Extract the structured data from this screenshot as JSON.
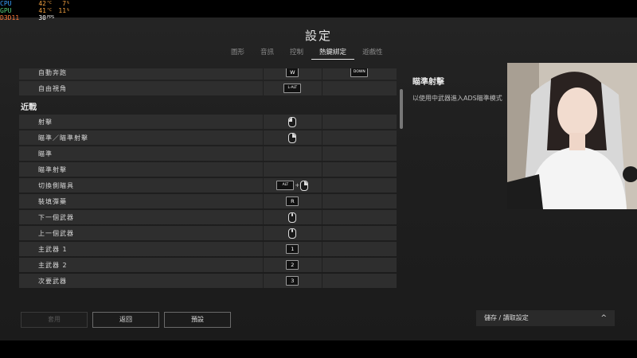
{
  "overlay": {
    "cpu": {
      "label": "CPU",
      "temp": "42",
      "load": "7"
    },
    "gpu": {
      "label": "GPU",
      "temp": "41",
      "load": "11"
    },
    "api": {
      "label": "D3D11",
      "fps": "30",
      "fps_unit": "FPS"
    },
    "temp_unit": "°C",
    "load_unit": "%"
  },
  "page_title": "設定",
  "tabs": [
    {
      "label": "圖形"
    },
    {
      "label": "音訊"
    },
    {
      "label": "控制"
    },
    {
      "label": "熱鍵綁定",
      "active": true
    },
    {
      "label": "遊戲性"
    }
  ],
  "bindings_top": [
    {
      "name": "自動奔跑",
      "key": "W",
      "key2": "DOWN"
    },
    {
      "name": "自由視角",
      "key": "L-ALT"
    }
  ],
  "section_label": "近戰",
  "bindings": [
    {
      "name": "射擊",
      "binding": "mouse-left"
    },
    {
      "name": "瞄準／瞄準射擊",
      "binding": "mouse-right"
    },
    {
      "name": "瞄準",
      "binding": ""
    },
    {
      "name": "瞄準射擊",
      "binding": ""
    },
    {
      "name": "切換側瞄具",
      "binding": "alt+mouse-right",
      "key": "ALT",
      "plus": "+"
    },
    {
      "name": "裝填彈藥",
      "binding": "key",
      "key": "R"
    },
    {
      "name": "下一個武器",
      "binding": "wheel-down"
    },
    {
      "name": "上一個武器",
      "binding": "wheel-up"
    },
    {
      "name": "主武器 1",
      "binding": "key",
      "key": "1"
    },
    {
      "name": "主武器 2",
      "binding": "key",
      "key": "2"
    },
    {
      "name": "次要武器",
      "binding": "key",
      "key": "3"
    }
  ],
  "description": {
    "title": "瞄準射擊",
    "text": "以使用中武器進入ADS瞄準模式"
  },
  "buttons": {
    "cancel": "套用",
    "back": "返回",
    "default": "預設"
  },
  "save_load": {
    "label": "儲存 / 讀取設定",
    "chevron": "^"
  }
}
